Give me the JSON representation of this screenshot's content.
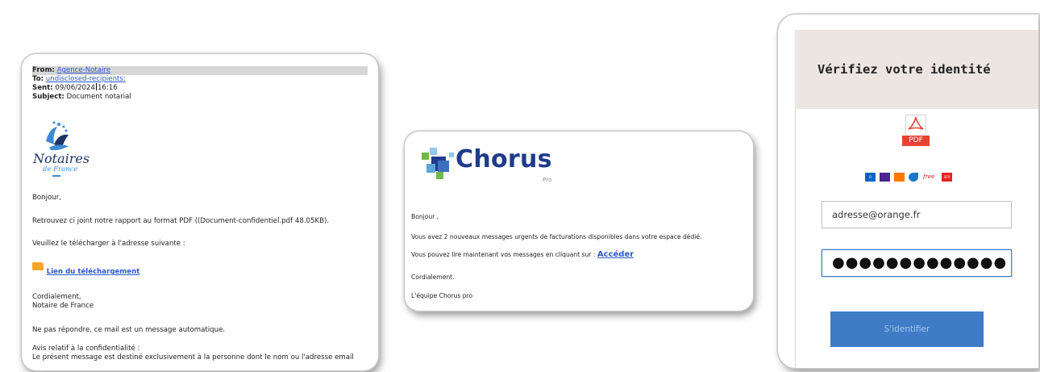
{
  "notaire_email": {
    "from_label": "From:",
    "from_value": "Agence-Notaire",
    "to_label": "To:",
    "to_value": "undisclosed-recipients:",
    "sent_label": "Sent:",
    "sent_date": "09/06/2024",
    "sent_time": "16:16",
    "subject_label": "Subject:",
    "subject_value": "Document notarial",
    "logo_line1": "Notaires",
    "logo_line2": "de France",
    "greeting": "Bonjour,",
    "line1": "Retrouvez ci joint notre rapport au format PDF ((Document-confidentiel.pdf 48.05KB).",
    "line2": "Veuillez le télécharger à l'adresse suivante :",
    "download_link": "Lien du téléchargement",
    "closing": "Cordialement,",
    "signature": "Notaire de France",
    "noreply": "Ne pas répondre, ce mail est un message automatique.",
    "conf_title": "Avis relatif à la confidentialité :",
    "conf_text": "Le présent message est destiné exclusivement à la personne dont le nom ou l'adresse email"
  },
  "chorus_email": {
    "logo_word": "Chorus",
    "logo_sub": "Pro",
    "greeting": "Bonjour ,",
    "line1": "Vous avez 2 nouveaux messages urgents de facturations disponibles dans votre espace dédié.",
    "line2": "Vous pouvez lire maintenant vos messages en cliquant sur :",
    "access_link": "Accéder",
    "closing": "Cordialement.",
    "signature": "L'équipe Chorus pro"
  },
  "identity_page": {
    "title": "Vérifiez votre identité",
    "pdf_label": "PDF",
    "providers": [
      "outlook-icon",
      "yahoo-icon",
      "orange-icon",
      "bouygues-icon",
      "free-icon",
      "sfr-icon"
    ],
    "free_label": "free",
    "sfr_label": "SFR",
    "email_value": "adresse@orange.fr",
    "password_masked": "●●●●●●●●●●●●●",
    "submit_label": "S'identifier"
  }
}
